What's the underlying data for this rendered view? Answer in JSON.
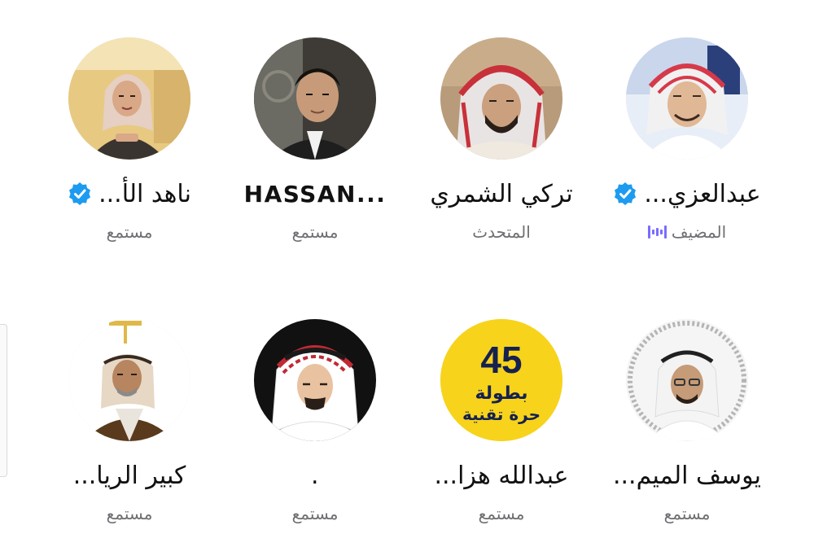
{
  "participants": [
    {
      "name": "عبدالعزي...",
      "verified": true,
      "role": "المضيف",
      "role_icon": "speaking-waveform-icon",
      "avatar": "avatar-man-white-shemagh"
    },
    {
      "name": "تركي الشمري",
      "verified": false,
      "role": "المتحدث",
      "avatar": "avatar-man-red-shemagh"
    },
    {
      "name": "HASSAN...",
      "verified": false,
      "role": "مستمع",
      "avatar": "avatar-young-man"
    },
    {
      "name": "ناهد الأ...",
      "verified": true,
      "role": "مستمع",
      "avatar": "avatar-woman-hijab"
    },
    {
      "name": "يوسف الميم...",
      "verified": false,
      "role": "مستمع",
      "avatar": "avatar-man-ghutra-framed"
    },
    {
      "name": "عبدالله هزا...",
      "verified": false,
      "role": "مستمع",
      "avatar": "avatar-logo-badge",
      "badge_number": "45",
      "badge_line1": "بطولة",
      "badge_line2": "حرة تقنية"
    },
    {
      "name": ".",
      "verified": false,
      "role": "مستمع",
      "avatar": "avatar-illustrated-man"
    },
    {
      "name": "كبير الريا...",
      "verified": false,
      "role": "مستمع",
      "avatar": "avatar-man-bisht"
    }
  ],
  "colors": {
    "verified_blue": "#1d9bf0",
    "host_wave": "#7b6cff",
    "role_gray": "#6e6e73",
    "badge_yellow": "#f7d31c",
    "badge_navy": "#16214f"
  }
}
